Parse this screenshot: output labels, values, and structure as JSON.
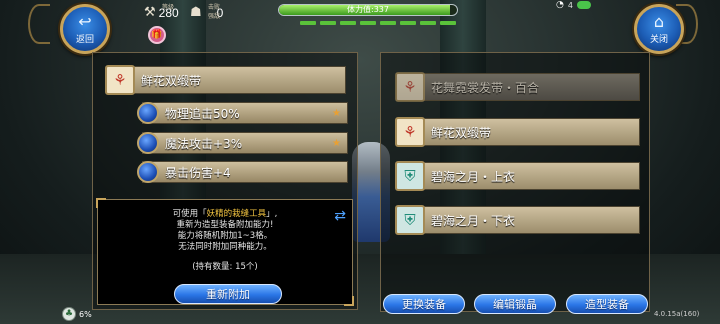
{
  "hud": {
    "back_label": "返回",
    "close_label": "关闭",
    "level_caption": "等级",
    "level_value": "280",
    "kills_caption": "击败强敌",
    "kills_value": "0",
    "stamina_text": "体力值:337",
    "stamina_fraction": 0.96,
    "top_right_text": "4"
  },
  "left": {
    "item_name": "鲜花双缎带",
    "attributes": [
      {
        "text": "物理追击50%",
        "star": "★"
      },
      {
        "text": "魔法攻击+3%",
        "star": "★"
      },
      {
        "text": "暴击伤害+4",
        "star": ""
      }
    ],
    "info_line1_pre": "可使用「",
    "info_line1_hl": "妖精的栽缝工具",
    "info_line1_post": "」,",
    "info_line2": "重新为造型装备附加能力!",
    "info_line3": "能力将随机附加1~3格。",
    "info_line4": "无法同时附加同种能力。",
    "held_text": "(持有数量: 15个)",
    "reattach_button": "重新附加"
  },
  "right": {
    "items": [
      {
        "name": "花舞霓裳发带・百合",
        "dim": true,
        "icon": "ribbon-icon"
      },
      {
        "name": "鲜花双缎带",
        "dim": false,
        "icon": "ribbon-icon"
      },
      {
        "name": "碧海之月・上衣",
        "dim": false,
        "icon": "armor-icon"
      },
      {
        "name": "碧海之月・下衣",
        "dim": false,
        "icon": "armor-icon"
      }
    ],
    "buttons": [
      "更换装备",
      "编辑锻晶",
      "造型装备"
    ]
  },
  "footer": {
    "percent": "6%",
    "version": "4.0.15a(160)"
  }
}
